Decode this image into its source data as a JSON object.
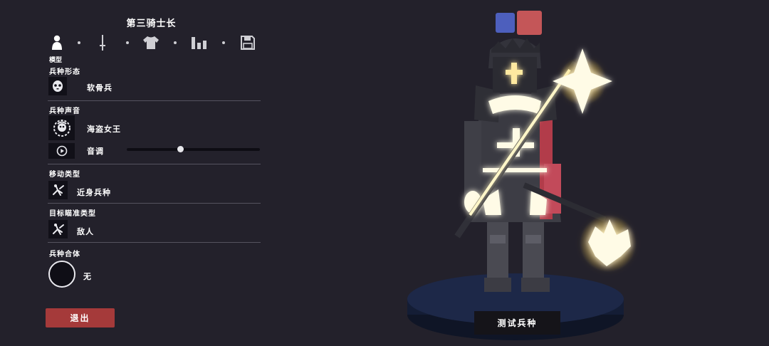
{
  "unit_name": "第三骑士长",
  "tabs": [
    {
      "icon": "person-icon",
      "label": "模型"
    },
    {
      "icon": "sword-icon"
    },
    {
      "icon": "shirt-icon"
    },
    {
      "icon": "stats-icon"
    },
    {
      "icon": "save-icon"
    }
  ],
  "sections": {
    "form": {
      "label": "兵种形态",
      "value": "软骨兵"
    },
    "voice": {
      "label": "兵种声音",
      "value": "海盗女王",
      "pitch_label": "音调",
      "pitch_level": 0.4
    },
    "movement": {
      "label": "移动类型",
      "value": "近身兵种"
    },
    "targeting": {
      "label": "目标瞄准类型",
      "value": "敌人"
    },
    "merge": {
      "label": "兵种合体",
      "value": "无"
    }
  },
  "buttons": {
    "exit": "退出",
    "test": "测试兵种"
  },
  "team_colors": {
    "blue": "#4d5fbd",
    "red": "#c45658"
  }
}
